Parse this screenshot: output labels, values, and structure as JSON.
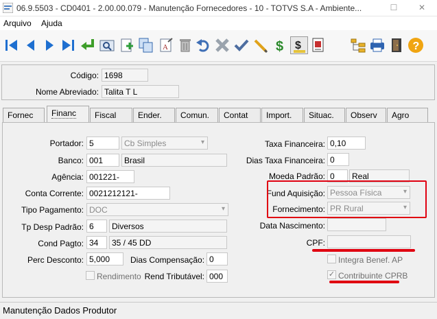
{
  "window": {
    "title": "06.9.5503 - CD0401 - 2.00.00.079 - Manutenção Fornecedores - 10 - TOTVS S.A - Ambiente..."
  },
  "menubar": {
    "items": [
      "Arquivo",
      "Ajuda"
    ]
  },
  "toolbar": {
    "icons": [
      "first-icon",
      "previous-icon",
      "next-icon",
      "last-icon",
      "goto-icon",
      "search-icon",
      "add-icon",
      "copy-icon",
      "edit-icon",
      "delete-icon",
      "undo-icon",
      "cancel-icon",
      "save-icon",
      "pencil-icon",
      "money-icon",
      "money-pressed-icon",
      "document-icon",
      "tree-icon",
      "print-icon",
      "exit-icon",
      "help-icon"
    ]
  },
  "header": {
    "codigo_label": "Código:",
    "codigo_value": "1698",
    "nome_label": "Nome Abreviado:",
    "nome_value": "Talita T L"
  },
  "tabs": [
    "Fornec",
    "Financ",
    "Fiscal",
    "Ender.",
    "Comun.",
    "Contat",
    "Import.",
    "Situac.",
    "Observ",
    "Agro"
  ],
  "active_tab": "Financ",
  "form": {
    "portador_label": "Portador:",
    "portador_value": "5",
    "portador_combo": "Cb Simples",
    "banco_label": "Banco:",
    "banco_value": "001",
    "banco_name": "Brasil",
    "agencia_label": "Agência:",
    "agencia_value": "001221-",
    "conta_label": "Conta Corrente:",
    "conta_value": "0021212121-",
    "tipo_pagamento_label": "Tipo Pagamento:",
    "tipo_pagamento_value": "DOC",
    "tp_desp_label": "Tp Desp Padrão:",
    "tp_desp_value": "6",
    "tp_desp_name": "Diversos",
    "cond_pagto_label": "Cond Pagto:",
    "cond_pagto_value": "34",
    "cond_pagto_name": "35 / 45 DD",
    "perc_desconto_label": "Perc Desconto:",
    "perc_desconto_value": "5,000",
    "dias_comp_label": "Dias Compensação:",
    "dias_comp_value": "0",
    "rendimento_label": "Rendimento",
    "rend_trib_label": "Rend Tributável:",
    "rend_trib_value": "000",
    "taxa_fin_label": "Taxa Financeira:",
    "taxa_fin_value": "0,10",
    "dias_taxa_label": "Dias Taxa Financeira:",
    "dias_taxa_value": "0",
    "moeda_label": "Moeda Padrão:",
    "moeda_value": "0",
    "moeda_name": "Real",
    "fund_aquisicao_label": "Fund Aquisição:",
    "fund_aquisicao_value": "Pessoa Física",
    "fornecimento_label": "Fornecimento:",
    "fornecimento_value": "PR Rural",
    "data_nasc_label": "Data Nascimento:",
    "data_nasc_value": "",
    "cpf_label": "CPF:",
    "cpf_value": "",
    "integra_label": "Integra Benef. AP",
    "contribuinte_label": "Contribuinte CPRB"
  },
  "statusbar": {
    "text": "Manutenção Dados Produtor"
  },
  "colors": {
    "highlight": "#e00010",
    "toolbar_blue": "#1e6fd0"
  }
}
